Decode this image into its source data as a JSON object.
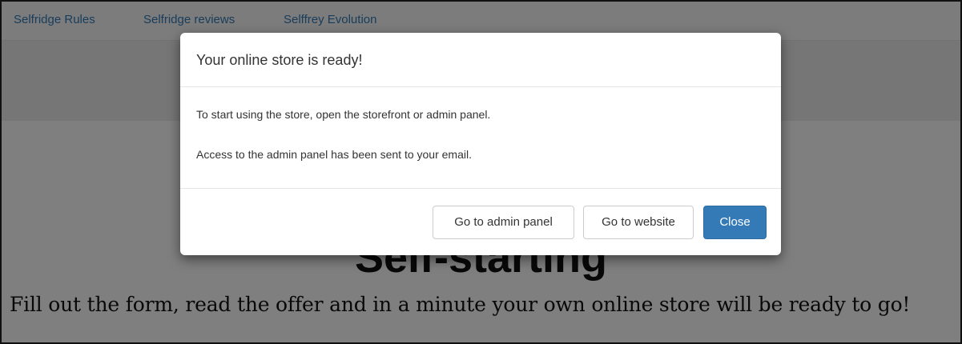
{
  "nav": {
    "items": [
      {
        "label": "Selfridge Rules"
      },
      {
        "label": "Selfridge reviews"
      },
      {
        "label": "Selffrey Evolution"
      }
    ]
  },
  "page": {
    "headline": "Self-starting",
    "lead": "Fill out the form, read the offer and in a minute your own online store will be ready to go!"
  },
  "modal": {
    "title": "Your online store is ready!",
    "body": [
      "To start using the store, open the storefront or admin panel.",
      "Access to the admin panel has been sent to your email."
    ],
    "buttons": {
      "admin": "Go to admin panel",
      "website": "Go to website",
      "close": "Close"
    }
  },
  "colors": {
    "primary": "#337ab7",
    "link": "#337ab7",
    "overlay": "rgba(0,0,0,0.5)"
  }
}
